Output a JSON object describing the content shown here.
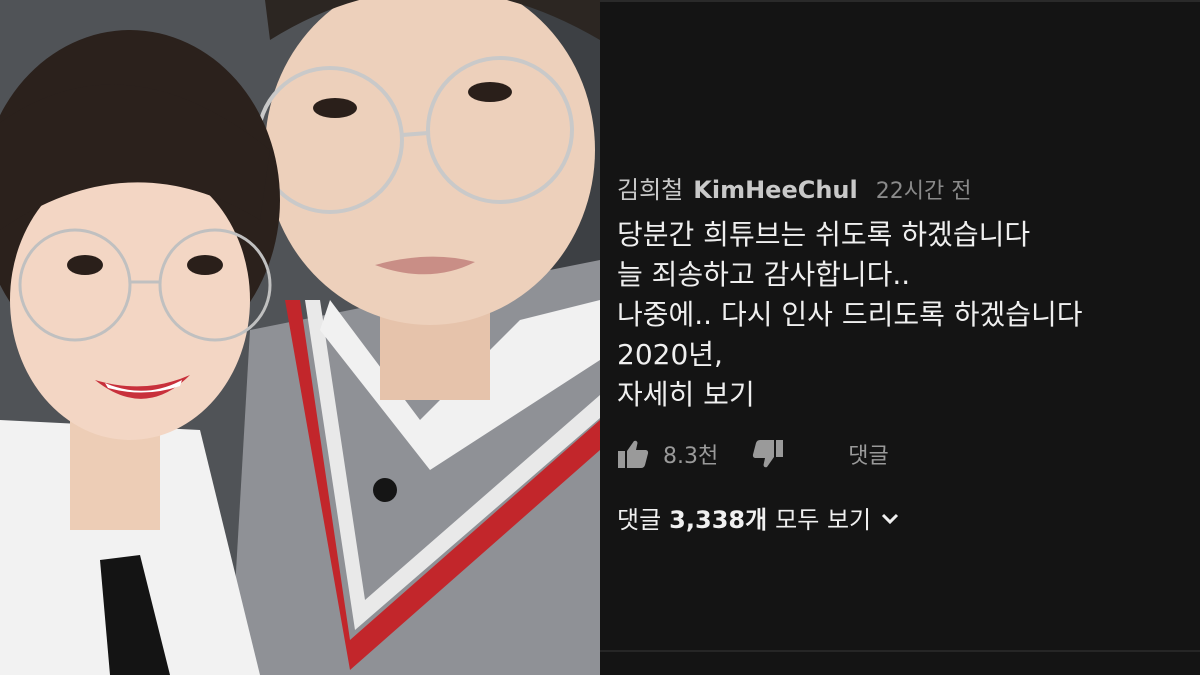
{
  "comment": {
    "author_korean": "김희철",
    "author_handle": "KimHeeChul",
    "timestamp": "22시간 전",
    "lines": [
      "당분간 희튜브는 쉬도록 하겠습니다",
      "늘 죄송하고 감사합니다..",
      "나중에.. 다시 인사 드리도록 하겠습니다",
      "2020년,",
      "자세히 보기"
    ],
    "like_count": "8.3천",
    "reply_label": "댓글"
  },
  "replies": {
    "label_prefix": "댓글",
    "count": "3,338개",
    "label_suffix": "모두 보기"
  },
  "icons": {
    "like": "thumbs-up-icon",
    "dislike": "thumbs-down-icon",
    "expand": "chevron-down-icon"
  },
  "colors": {
    "panel_bg": "#141414",
    "text_primary": "#efefef",
    "text_secondary": "#9a9a9a"
  }
}
